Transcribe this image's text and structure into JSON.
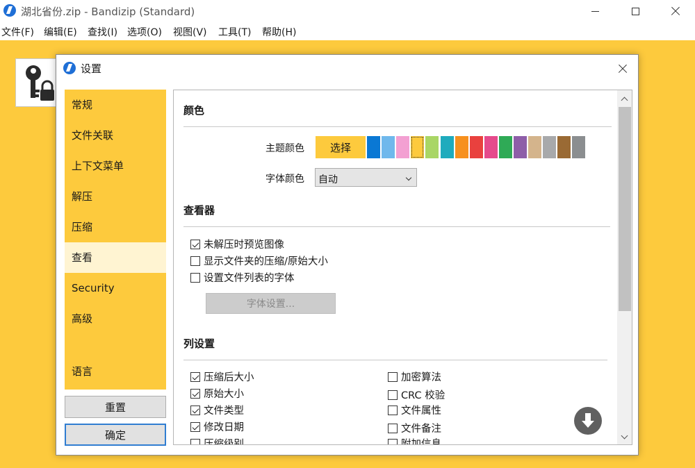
{
  "window": {
    "title": "湖北省份.zip - Bandizip (Standard)"
  },
  "menu": [
    "文件(F)",
    "编辑(E)",
    "查找(I)",
    "选项(O)",
    "视图(V)",
    "工具(T)",
    "帮助(H)"
  ],
  "dialog": {
    "title": "设置",
    "nav": [
      "常规",
      "文件关联",
      "上下文菜单",
      "解压",
      "压缩",
      "查看",
      "Security",
      "高级",
      "语言"
    ],
    "active_nav": "查看",
    "buttons": {
      "reset": "重置",
      "ok": "确定"
    }
  },
  "color_section": {
    "title": "颜色",
    "theme_label": "主题颜色",
    "theme_button": "选择",
    "swatches": [
      "#0a78d4",
      "#6fb8ec",
      "#f3a0d2",
      "#fdca3d",
      "#a9d665",
      "#1fabbd",
      "#f7901e",
      "#e9413e",
      "#e54b8c",
      "#2faa56",
      "#8e5ea8",
      "#d4b48c",
      "#a8a9ab",
      "#9a6a34",
      "#8b8e90"
    ],
    "selected_swatch": 3,
    "font_label": "字体颜色",
    "font_value": "自动"
  },
  "viewer_section": {
    "title": "查看器",
    "options": [
      {
        "label": "未解压时预览图像",
        "checked": true
      },
      {
        "label": "显示文件夹的压缩/原始大小",
        "checked": false
      },
      {
        "label": "设置文件列表的字体",
        "checked": false
      }
    ],
    "font_button": "字体设置..."
  },
  "columns_section": {
    "title": "列设置",
    "left": [
      {
        "label": "压缩后大小",
        "checked": true
      },
      {
        "label": "原始大小",
        "checked": true
      },
      {
        "label": "文件类型",
        "checked": true
      },
      {
        "label": "修改日期",
        "checked": true
      },
      {
        "label": "压缩级别",
        "checked": false
      }
    ],
    "right": [
      {
        "label": "加密算法",
        "checked": false
      },
      {
        "label": "CRC 校验",
        "checked": false
      },
      {
        "label": "文件属性",
        "checked": false
      },
      {
        "label": "文件备注",
        "checked": false
      },
      {
        "label": "附加信息",
        "checked": false
      }
    ]
  }
}
